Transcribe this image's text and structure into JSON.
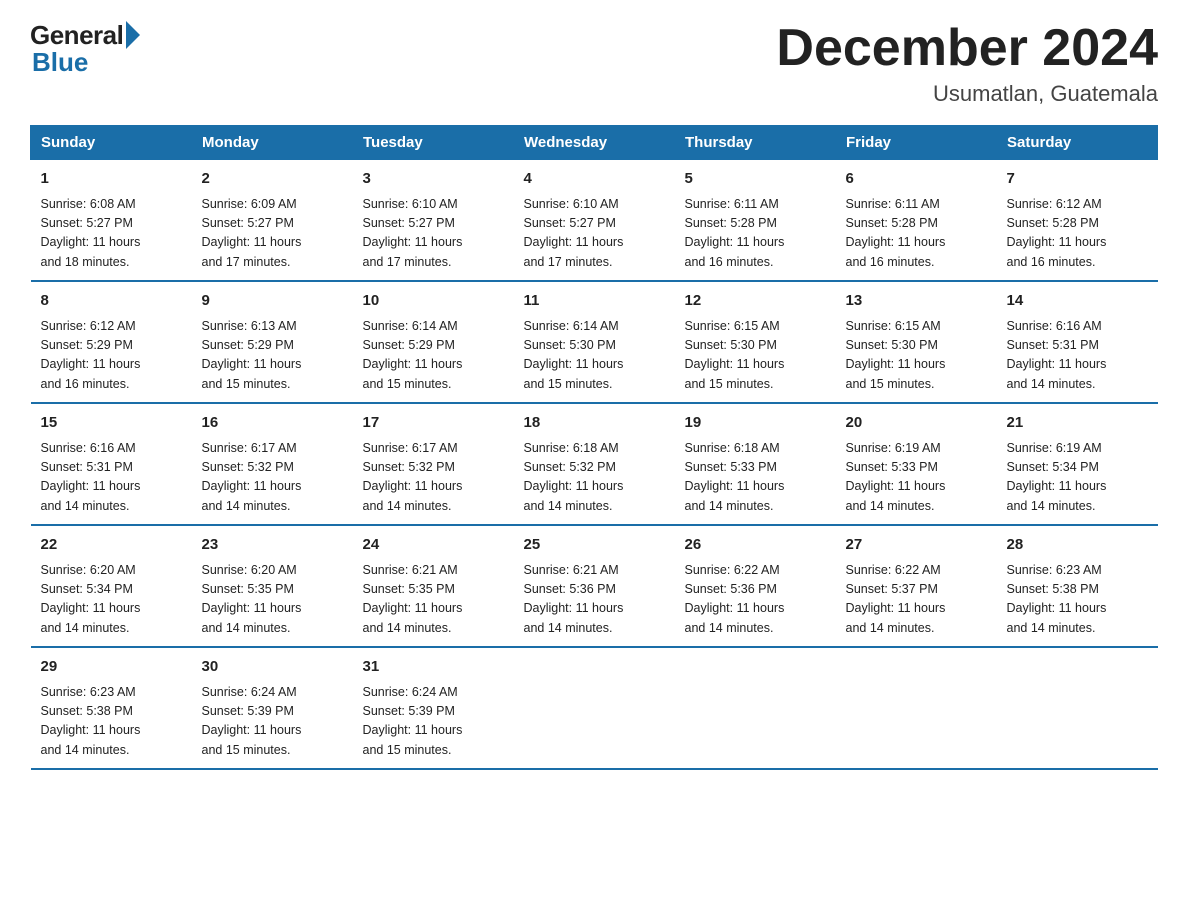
{
  "header": {
    "logo_general": "General",
    "logo_blue": "Blue",
    "month_title": "December 2024",
    "subtitle": "Usumatlan, Guatemala"
  },
  "days_of_week": [
    "Sunday",
    "Monday",
    "Tuesday",
    "Wednesday",
    "Thursday",
    "Friday",
    "Saturday"
  ],
  "weeks": [
    [
      {
        "num": "1",
        "sunrise": "6:08 AM",
        "sunset": "5:27 PM",
        "daylight": "11 hours and 18 minutes."
      },
      {
        "num": "2",
        "sunrise": "6:09 AM",
        "sunset": "5:27 PM",
        "daylight": "11 hours and 17 minutes."
      },
      {
        "num": "3",
        "sunrise": "6:10 AM",
        "sunset": "5:27 PM",
        "daylight": "11 hours and 17 minutes."
      },
      {
        "num": "4",
        "sunrise": "6:10 AM",
        "sunset": "5:27 PM",
        "daylight": "11 hours and 17 minutes."
      },
      {
        "num": "5",
        "sunrise": "6:11 AM",
        "sunset": "5:28 PM",
        "daylight": "11 hours and 16 minutes."
      },
      {
        "num": "6",
        "sunrise": "6:11 AM",
        "sunset": "5:28 PM",
        "daylight": "11 hours and 16 minutes."
      },
      {
        "num": "7",
        "sunrise": "6:12 AM",
        "sunset": "5:28 PM",
        "daylight": "11 hours and 16 minutes."
      }
    ],
    [
      {
        "num": "8",
        "sunrise": "6:12 AM",
        "sunset": "5:29 PM",
        "daylight": "11 hours and 16 minutes."
      },
      {
        "num": "9",
        "sunrise": "6:13 AM",
        "sunset": "5:29 PM",
        "daylight": "11 hours and 15 minutes."
      },
      {
        "num": "10",
        "sunrise": "6:14 AM",
        "sunset": "5:29 PM",
        "daylight": "11 hours and 15 minutes."
      },
      {
        "num": "11",
        "sunrise": "6:14 AM",
        "sunset": "5:30 PM",
        "daylight": "11 hours and 15 minutes."
      },
      {
        "num": "12",
        "sunrise": "6:15 AM",
        "sunset": "5:30 PM",
        "daylight": "11 hours and 15 minutes."
      },
      {
        "num": "13",
        "sunrise": "6:15 AM",
        "sunset": "5:30 PM",
        "daylight": "11 hours and 15 minutes."
      },
      {
        "num": "14",
        "sunrise": "6:16 AM",
        "sunset": "5:31 PM",
        "daylight": "11 hours and 14 minutes."
      }
    ],
    [
      {
        "num": "15",
        "sunrise": "6:16 AM",
        "sunset": "5:31 PM",
        "daylight": "11 hours and 14 minutes."
      },
      {
        "num": "16",
        "sunrise": "6:17 AM",
        "sunset": "5:32 PM",
        "daylight": "11 hours and 14 minutes."
      },
      {
        "num": "17",
        "sunrise": "6:17 AM",
        "sunset": "5:32 PM",
        "daylight": "11 hours and 14 minutes."
      },
      {
        "num": "18",
        "sunrise": "6:18 AM",
        "sunset": "5:32 PM",
        "daylight": "11 hours and 14 minutes."
      },
      {
        "num": "19",
        "sunrise": "6:18 AM",
        "sunset": "5:33 PM",
        "daylight": "11 hours and 14 minutes."
      },
      {
        "num": "20",
        "sunrise": "6:19 AM",
        "sunset": "5:33 PM",
        "daylight": "11 hours and 14 minutes."
      },
      {
        "num": "21",
        "sunrise": "6:19 AM",
        "sunset": "5:34 PM",
        "daylight": "11 hours and 14 minutes."
      }
    ],
    [
      {
        "num": "22",
        "sunrise": "6:20 AM",
        "sunset": "5:34 PM",
        "daylight": "11 hours and 14 minutes."
      },
      {
        "num": "23",
        "sunrise": "6:20 AM",
        "sunset": "5:35 PM",
        "daylight": "11 hours and 14 minutes."
      },
      {
        "num": "24",
        "sunrise": "6:21 AM",
        "sunset": "5:35 PM",
        "daylight": "11 hours and 14 minutes."
      },
      {
        "num": "25",
        "sunrise": "6:21 AM",
        "sunset": "5:36 PM",
        "daylight": "11 hours and 14 minutes."
      },
      {
        "num": "26",
        "sunrise": "6:22 AM",
        "sunset": "5:36 PM",
        "daylight": "11 hours and 14 minutes."
      },
      {
        "num": "27",
        "sunrise": "6:22 AM",
        "sunset": "5:37 PM",
        "daylight": "11 hours and 14 minutes."
      },
      {
        "num": "28",
        "sunrise": "6:23 AM",
        "sunset": "5:38 PM",
        "daylight": "11 hours and 14 minutes."
      }
    ],
    [
      {
        "num": "29",
        "sunrise": "6:23 AM",
        "sunset": "5:38 PM",
        "daylight": "11 hours and 14 minutes."
      },
      {
        "num": "30",
        "sunrise": "6:24 AM",
        "sunset": "5:39 PM",
        "daylight": "11 hours and 15 minutes."
      },
      {
        "num": "31",
        "sunrise": "6:24 AM",
        "sunset": "5:39 PM",
        "daylight": "11 hours and 15 minutes."
      },
      null,
      null,
      null,
      null
    ]
  ],
  "labels": {
    "sunrise": "Sunrise:",
    "sunset": "Sunset:",
    "daylight": "Daylight:"
  }
}
